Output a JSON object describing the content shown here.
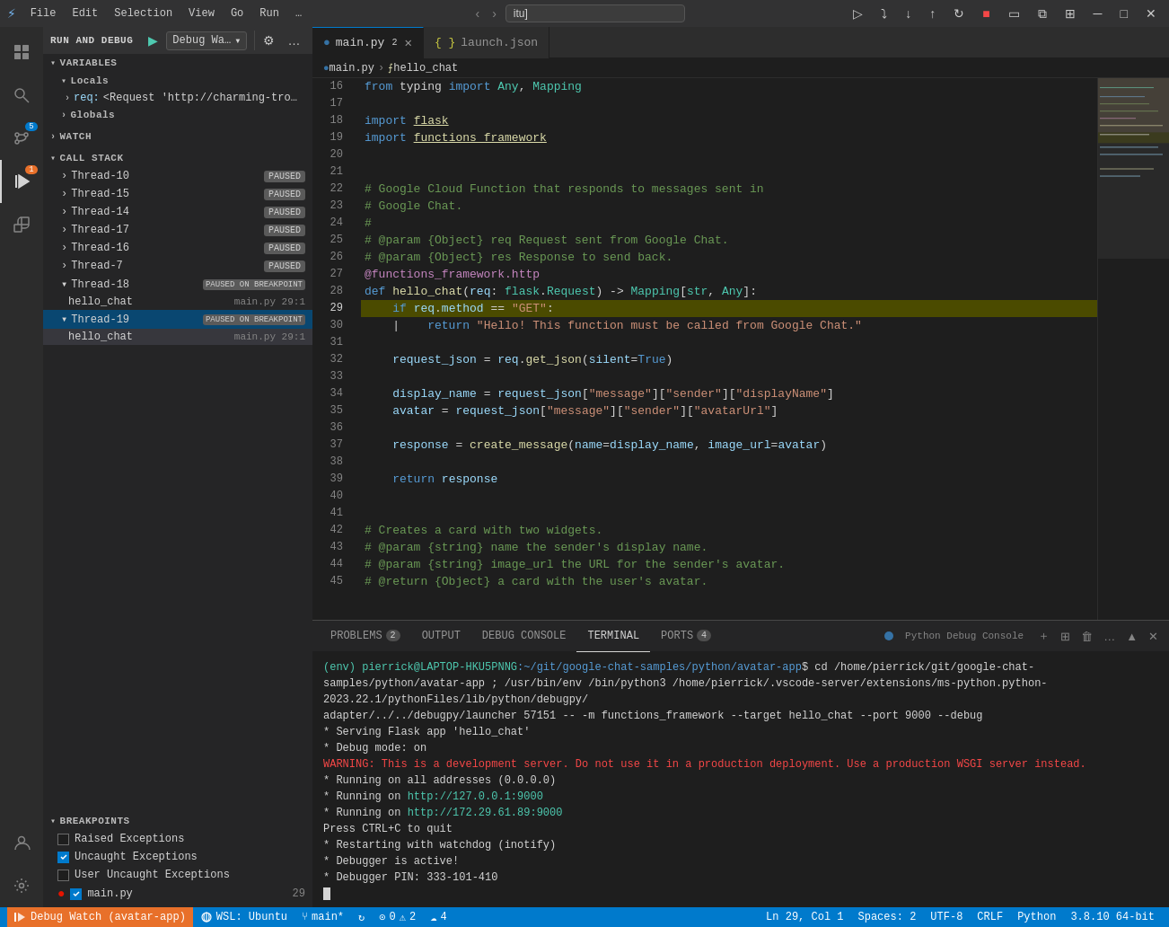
{
  "titlebar": {
    "icon": "⚡",
    "menus": [
      "File",
      "Edit",
      "Selection",
      "View",
      "Go",
      "Run",
      "…"
    ],
    "search_value": "itu]",
    "title": "Debug Watch (avatar-app)"
  },
  "activity_bar": {
    "items": [
      {
        "name": "explorer",
        "icon": "⧉",
        "active": false
      },
      {
        "name": "search",
        "icon": "🔍",
        "active": false
      },
      {
        "name": "source-control",
        "icon": "⑂",
        "active": false,
        "badge": "5",
        "badge_color": "blue"
      },
      {
        "name": "run-debug",
        "icon": "▶",
        "active": true,
        "badge": "1",
        "badge_color": "orange"
      },
      {
        "name": "extensions",
        "icon": "⊞",
        "active": false
      },
      {
        "name": "remote-explorer",
        "icon": "🖥",
        "active": false
      },
      {
        "name": "accounts",
        "icon": "👤",
        "active": false
      },
      {
        "name": "settings",
        "icon": "⚙",
        "active": false
      }
    ]
  },
  "sidebar": {
    "title": "Run and Debug",
    "debug_label": "RUN AND DEBUG",
    "config_name": "Debug Wa…",
    "sections": {
      "variables": {
        "title": "VARIABLES",
        "locals": {
          "title": "Locals",
          "items": [
            {
              "key": "req:",
              "val": "<Request 'http://charming-tro…"
            }
          ]
        },
        "globals": {
          "title": "Globals"
        }
      },
      "watch": {
        "title": "WATCH"
      },
      "call_stack": {
        "title": "CALL STACK",
        "threads": [
          {
            "name": "Thread-10",
            "badge": "PAUSED",
            "type": "simple"
          },
          {
            "name": "Thread-15",
            "badge": "PAUSED",
            "type": "simple"
          },
          {
            "name": "Thread-14",
            "badge": "PAUSED",
            "type": "simple"
          },
          {
            "name": "Thread-17",
            "badge": "PAUSED",
            "type": "simple"
          },
          {
            "name": "Thread-16",
            "badge": "PAUSED",
            "type": "simple"
          },
          {
            "name": "Thread-7",
            "badge": "PAUSED",
            "type": "simple"
          },
          {
            "name": "Thread-18",
            "badge": "PAUSED ON BREAKPOINT",
            "type": "expanded",
            "frames": [
              {
                "name": "hello_chat",
                "file": "main.py",
                "line": "29:1"
              }
            ]
          },
          {
            "name": "Thread-19",
            "badge": "PAUSED ON BREAKPOINT",
            "type": "expanded",
            "frames": [
              {
                "name": "hello_chat",
                "file": "main.py",
                "line": "29:1",
                "selected": true
              }
            ]
          }
        ]
      },
      "breakpoints": {
        "title": "BREAKPOINTS",
        "items": [
          {
            "label": "Raised Exceptions",
            "checked": false
          },
          {
            "label": "Uncaught Exceptions",
            "checked": true
          },
          {
            "label": "User Uncaught Exceptions",
            "checked": false
          },
          {
            "label": "main.py",
            "checked": true,
            "is_file": true,
            "line": "29"
          }
        ]
      }
    }
  },
  "editor": {
    "tabs": [
      {
        "label": "main.py",
        "lang": "py",
        "modified": true,
        "active": true
      },
      {
        "label": "launch.json",
        "lang": "json",
        "modified": false,
        "active": false
      }
    ],
    "breadcrumb": [
      "main.py",
      "hello_chat"
    ],
    "lines": [
      {
        "num": 16,
        "code": "from typing import Any, Mapping",
        "tokens": [
          {
            "t": "kw",
            "v": "from"
          },
          {
            "t": "op",
            "v": " typing "
          },
          {
            "t": "kw",
            "v": "import"
          },
          {
            "t": "op",
            "v": " "
          },
          {
            "t": "type",
            "v": "Any"
          },
          {
            "t": "op",
            "v": ", "
          },
          {
            "t": "type",
            "v": "Mapping"
          }
        ]
      },
      {
        "num": 17,
        "code": ""
      },
      {
        "num": 18,
        "code": "import flask",
        "tokens": [
          {
            "t": "kw",
            "v": "import"
          },
          {
            "t": "op",
            "v": " "
          },
          {
            "t": "fn",
            "v": "flask"
          }
        ]
      },
      {
        "num": 19,
        "code": "import functions_framework",
        "tokens": [
          {
            "t": "kw",
            "v": "import"
          },
          {
            "t": "op",
            "v": " "
          },
          {
            "t": "fn",
            "v": "functions_framework"
          }
        ]
      },
      {
        "num": 20,
        "code": ""
      },
      {
        "num": 21,
        "code": ""
      },
      {
        "num": 22,
        "code": "# Google Cloud Function that responds to messages sent in",
        "cmt": true
      },
      {
        "num": 23,
        "code": "# Google Chat.",
        "cmt": true
      },
      {
        "num": 24,
        "code": "#",
        "cmt": true
      },
      {
        "num": 25,
        "code": "# @param {Object} req Request sent from Google Chat.",
        "cmt": true
      },
      {
        "num": 26,
        "code": "# @param {Object} res Response to send back.",
        "cmt": true
      },
      {
        "num": 27,
        "code": "@functions_framework.http",
        "tokens": [
          {
            "t": "dec",
            "v": "@functions_framework.http"
          }
        ]
      },
      {
        "num": 28,
        "code": "def hello_chat(req: flask.Request) -> Mapping[str, Any]:",
        "tokens": [
          {
            "t": "kw",
            "v": "def"
          },
          {
            "t": "op",
            "v": " "
          },
          {
            "t": "fn",
            "v": "hello_chat"
          },
          {
            "t": "op",
            "v": "("
          },
          {
            "t": "param",
            "v": "req"
          },
          {
            "t": "op",
            "v": ": "
          },
          {
            "t": "type",
            "v": "flask"
          },
          {
            "t": "op",
            "v": "."
          },
          {
            "t": "type",
            "v": "Request"
          },
          {
            "t": "op",
            "v": ") -> "
          },
          {
            "t": "type",
            "v": "Mapping"
          },
          {
            "t": "op",
            "v": "["
          },
          {
            "t": "type",
            "v": "str"
          },
          {
            "t": "op",
            "v": ", "
          },
          {
            "t": "type",
            "v": "Any"
          },
          {
            "t": "op",
            "v": "]:"
          }
        ]
      },
      {
        "num": 29,
        "code": "    if req.method == \"GET\":",
        "highlight": true,
        "debug_arrow": true,
        "tokens": [
          {
            "t": "op",
            "v": "    "
          },
          {
            "t": "kw",
            "v": "if"
          },
          {
            "t": "op",
            "v": " "
          },
          {
            "t": "var",
            "v": "req"
          },
          {
            "t": "op",
            "v": "."
          },
          {
            "t": "var",
            "v": "method"
          },
          {
            "t": "op",
            "v": " == "
          },
          {
            "t": "str",
            "v": "\"GET\""
          }
        ]
      },
      {
        "num": 30,
        "code": "        return \"Hello! This function must be called from Google Chat.\"",
        "tokens": [
          {
            "t": "op",
            "v": "        "
          },
          {
            "t": "kw",
            "v": "return"
          },
          {
            "t": "op",
            "v": " "
          },
          {
            "t": "str",
            "v": "\"Hello! This function must be called from Google Chat.\""
          }
        ]
      },
      {
        "num": 31,
        "code": ""
      },
      {
        "num": 32,
        "code": "    request_json = req.get_json(silent=True)",
        "tokens": [
          {
            "t": "op",
            "v": "    "
          },
          {
            "t": "var",
            "v": "request_json"
          },
          {
            "t": "op",
            "v": " = "
          },
          {
            "t": "var",
            "v": "req"
          },
          {
            "t": "op",
            "v": "."
          },
          {
            "t": "fn",
            "v": "get_json"
          },
          {
            "t": "op",
            "v": "("
          },
          {
            "t": "param",
            "v": "silent"
          },
          {
            "t": "op",
            "v": "="
          },
          {
            "t": "kw",
            "v": "True"
          },
          {
            "t": "op",
            "v": ")"
          }
        ]
      },
      {
        "num": 33,
        "code": ""
      },
      {
        "num": 34,
        "code": "    display_name = request_json[\"message\"][\"sender\"][\"displayName\"]",
        "tokens": [
          {
            "t": "op",
            "v": "    "
          },
          {
            "t": "var",
            "v": "display_name"
          },
          {
            "t": "op",
            "v": " = "
          },
          {
            "t": "var",
            "v": "request_json"
          },
          {
            "t": "op",
            "v": "["
          },
          {
            "t": "str",
            "v": "\"message\""
          },
          {
            "t": "op",
            "v": "]["
          },
          {
            "t": "str",
            "v": "\"sender\""
          },
          {
            "t": "op",
            "v": "]["
          },
          {
            "t": "str",
            "v": "\"displayName\""
          },
          {
            "t": "op",
            "v": "]"
          }
        ]
      },
      {
        "num": 35,
        "code": "    avatar = request_json[\"message\"][\"sender\"][\"avatarUrl\"]",
        "tokens": [
          {
            "t": "op",
            "v": "    "
          },
          {
            "t": "var",
            "v": "avatar"
          },
          {
            "t": "op",
            "v": " = "
          },
          {
            "t": "var",
            "v": "request_json"
          },
          {
            "t": "op",
            "v": "["
          },
          {
            "t": "str",
            "v": "\"message\""
          },
          {
            "t": "op",
            "v": "]["
          },
          {
            "t": "str",
            "v": "\"sender\""
          },
          {
            "t": "op",
            "v": "]["
          },
          {
            "t": "str",
            "v": "\"avatarUrl\""
          },
          {
            "t": "op",
            "v": "]"
          }
        ]
      },
      {
        "num": 36,
        "code": ""
      },
      {
        "num": 37,
        "code": "    response = create_message(name=display_name, image_url=avatar)",
        "tokens": [
          {
            "t": "op",
            "v": "    "
          },
          {
            "t": "var",
            "v": "response"
          },
          {
            "t": "op",
            "v": " = "
          },
          {
            "t": "fn",
            "v": "create_message"
          },
          {
            "t": "op",
            "v": "("
          },
          {
            "t": "param",
            "v": "name"
          },
          {
            "t": "op",
            "v": "="
          },
          {
            "t": "var",
            "v": "display_name"
          },
          {
            "t": "op",
            "v": ", "
          },
          {
            "t": "param",
            "v": "image_url"
          },
          {
            "t": "op",
            "v": "="
          },
          {
            "t": "var",
            "v": "avatar"
          },
          {
            "t": "op",
            "v": ")"
          }
        ]
      },
      {
        "num": 38,
        "code": ""
      },
      {
        "num": 39,
        "code": "    return response",
        "tokens": [
          {
            "t": "op",
            "v": "    "
          },
          {
            "t": "kw",
            "v": "return"
          },
          {
            "t": "op",
            "v": " "
          },
          {
            "t": "var",
            "v": "response"
          }
        ]
      },
      {
        "num": 40,
        "code": ""
      },
      {
        "num": 41,
        "code": ""
      },
      {
        "num": 42,
        "code": "# Creates a card with two widgets.",
        "cmt": true
      },
      {
        "num": 43,
        "code": "# @param {string} name the sender's display name.",
        "cmt": true
      },
      {
        "num": 44,
        "code": "# @param {string} image_url the URL for the sender's avatar.",
        "cmt": true
      },
      {
        "num": 45,
        "code": "# @return {Object} a card with the user's avatar.",
        "cmt": true
      }
    ]
  },
  "terminal": {
    "tabs": [
      {
        "label": "PROBLEMS",
        "badge": "2"
      },
      {
        "label": "OUTPUT",
        "badge": ""
      },
      {
        "label": "DEBUG CONSOLE",
        "badge": ""
      },
      {
        "label": "TERMINAL",
        "badge": "",
        "active": true
      },
      {
        "label": "PORTS",
        "badge": "4"
      }
    ],
    "python_debug_label": "Python Debug Console",
    "content": [
      {
        "type": "prompt",
        "user": "(env) pierrick@LAPTOP-HKU5PNNG",
        "path": ":~/git/google-chat-samples/python/avatar-app",
        "symbol": "$",
        "cmd": " cd /home/pierrick/git/google-chat-samples/python/avatar-app ; /usr/bin/env /bin/python3 /home/pierrick/.vscode-server/extensions/ms-python.python-2023.22.1/pythonFiles/lib/python/debugpy/adapter/../../debugpy/launcher 57151 -- -m functions_framework --target hello_chat --port 9000 --debug"
      },
      {
        "type": "info",
        "text": " * Serving Flask app 'hello_chat'"
      },
      {
        "type": "info",
        "text": " * Debug mode: on"
      },
      {
        "type": "warning",
        "text": "WARNING: This is a development server. Do not use it in a production deployment. Use a production WSGI server instead."
      },
      {
        "type": "info",
        "text": " * Running on all addresses (0.0.0.0)"
      },
      {
        "type": "info",
        "text": " * Running on http://127.0.0.1:9000"
      },
      {
        "type": "info",
        "text": " * Running on http://172.29.61.89:9000"
      },
      {
        "type": "info",
        "text": "Press CTRL+C to quit"
      },
      {
        "type": "info",
        "text": " * Restarting with watchdog (inotify)"
      },
      {
        "type": "info",
        "text": " * Debugger is active!"
      },
      {
        "type": "info",
        "text": " * Debugger PIN: 333-101-410"
      }
    ]
  },
  "status_bar": {
    "left_items": [
      {
        "icon": "🌐",
        "text": "WSL: Ubuntu"
      },
      {
        "icon": "⑂",
        "text": "main*"
      },
      {
        "icon": "↺",
        "text": ""
      },
      {
        "icon": "⊙",
        "text": "0"
      },
      {
        "icon": "⚠",
        "text": "0 △ 2"
      },
      {
        "icon": "☁",
        "text": "4"
      }
    ],
    "right_items": [
      {
        "text": "Ln 29, Col 1"
      },
      {
        "text": "Spaces: 2"
      },
      {
        "text": "UTF-8"
      },
      {
        "text": "CRLF"
      },
      {
        "text": "Python"
      },
      {
        "text": "3.8.10 64-bit"
      }
    ],
    "debug_text": "Debug Watch (avatar-app)"
  }
}
